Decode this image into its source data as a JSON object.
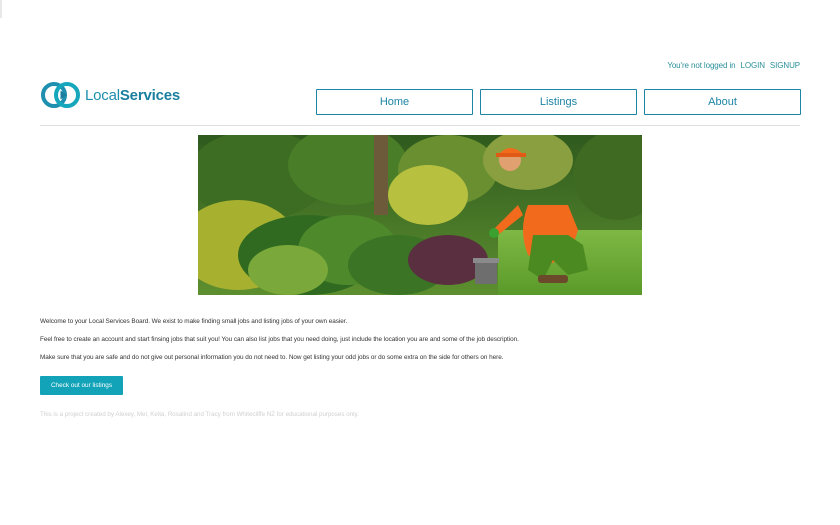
{
  "header": {
    "auth_status": "You're not logged in",
    "login_label": "LOGIN",
    "signup_label": "SIGNUP",
    "logo_part1": "Local",
    "logo_part2": "Services",
    "nav": [
      {
        "label": "Home"
      },
      {
        "label": "Listings"
      },
      {
        "label": "About"
      }
    ]
  },
  "main": {
    "hero_icon": "gardener-photo",
    "paragraphs": [
      "Welcome to your Local Services Board. We exist to make finding small jobs and listing jobs of your own easier.",
      "Feel free to create an account and start finsing jobs that suit you! You can also list jobs that you need doing, just include the location you are and some of the job description.",
      "Make sure that you are safe and do not give out personal information you do not need to. Now get listing your odd jobs or do some extra on the side for others on here."
    ],
    "cta_label": "Check out our listings"
  },
  "footer": {
    "note": "This is a project created by Alexey, Mel, Keita, Rosalind and Tracy from Whitecliffe NZ for educational purposes only."
  },
  "colors": {
    "brand": "#1d84a5",
    "accent": "#12a3b8",
    "auth": "#2a8f9a"
  }
}
